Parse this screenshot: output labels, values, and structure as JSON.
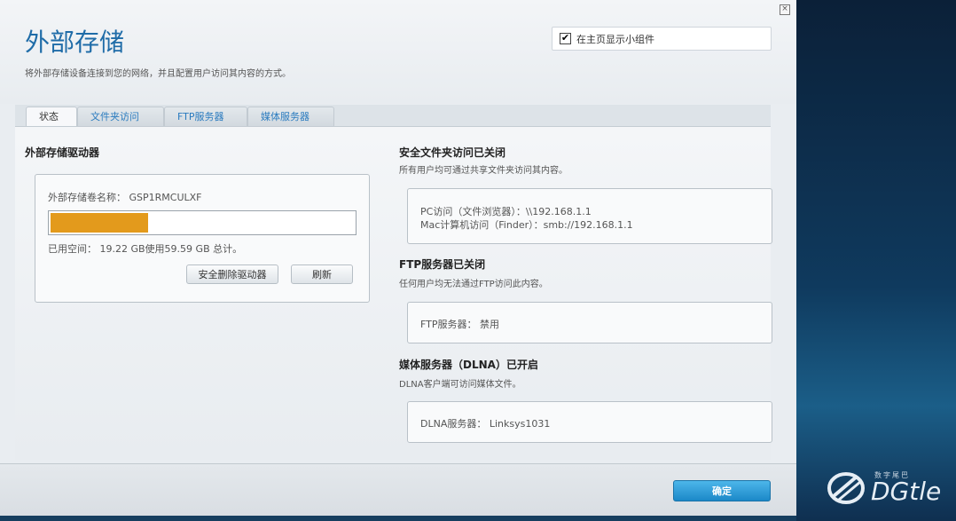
{
  "header": {
    "title": "外部存储",
    "subtitle": "将外部存储设备连接到您的网络，并且配置用户访问其内容的方式。",
    "close_label": "×",
    "widget_checkbox_label": "在主页显示小组件",
    "widget_checked": "✔"
  },
  "tabs": [
    "状态",
    "文件夹访问",
    "FTP服务器",
    "媒体服务器"
  ],
  "drive": {
    "heading": "外部存储驱动器",
    "volume_label": "外部存储卷名称： GSP1RMCULXF",
    "used_fraction": 0.323,
    "usage_text": "已用空间： 19.22 GB使用59.59 GB 总计。",
    "safe_remove_button": "安全删除驱动器",
    "refresh_button": "刷新"
  },
  "folder_access": {
    "heading": "安全文件夹访问已关闭",
    "sub": "所有用户均可通过共享文件夹访问其内容。",
    "pc_line": "PC访问（文件浏览器）：\\\\192.168.1.1",
    "mac_line": "Mac计算机访问（Finder）：smb://192.168.1.1"
  },
  "ftp": {
    "heading": "FTP服务器已关闭",
    "sub": "任何用户均无法通过FTP访问此内容。",
    "status_line": "FTP服务器： 禁用"
  },
  "dlna": {
    "heading": "媒体服务器（DLNA）已开启",
    "sub": "DLNA客户端可访问媒体文件。",
    "status_line": "DLNA服务器： Linksys1031"
  },
  "footer": {
    "ok_button": "确定"
  },
  "logo": {
    "small": "数字尾巴",
    "text": "DGtle"
  },
  "colors": {
    "accent": "#1f6ca8",
    "progress": "#e39a1c",
    "ok_button": "#1b88c8"
  }
}
